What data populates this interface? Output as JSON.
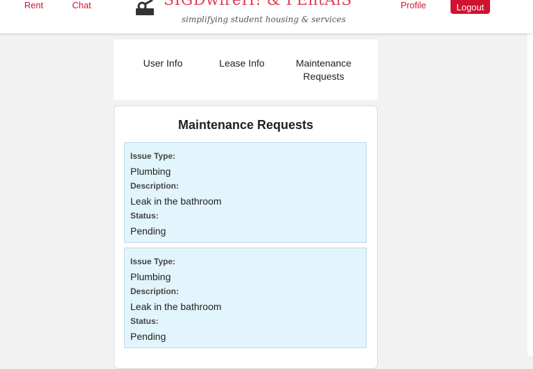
{
  "nav": {
    "rent_label": "Rent",
    "chat_label": "Chat",
    "brand_title": "SIGDwireH! & PEntAlS",
    "brand_tagline": "simplifying student housing & services",
    "profile_label": "Profile",
    "logout_label": "Logout"
  },
  "tabs": [
    {
      "label": "User Info"
    },
    {
      "label": "Lease Info"
    },
    {
      "label": "Maintenance Requests"
    }
  ],
  "maintenance": {
    "title": "Maintenance Requests",
    "requests": [
      {
        "issue_type_label": "Issue Type:",
        "issue_type": "Plumbing",
        "description_label": "Description:",
        "description": "Leak in the bathroom",
        "status_label": "Status:",
        "status": "Pending"
      },
      {
        "issue_type_label": "Issue Type:",
        "issue_type": "Plumbing",
        "description_label": "Description:",
        "description": "Leak in the bathroom",
        "status_label": "Status:",
        "status": "Pending"
      }
    ]
  },
  "colors": {
    "brand": "#d0132f",
    "request_background": "#e3f5fc",
    "page_background": "#f2f2f2"
  },
  "icons": {
    "brand": "key-logo-icon"
  }
}
